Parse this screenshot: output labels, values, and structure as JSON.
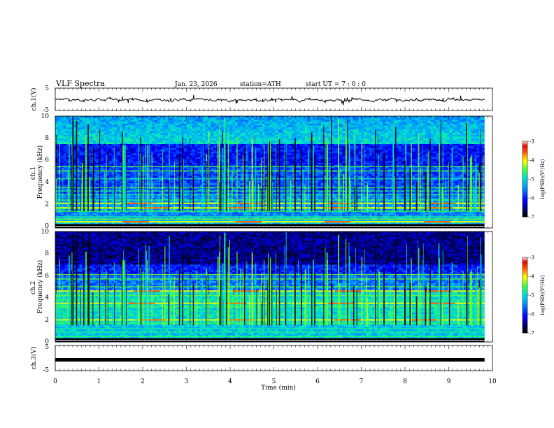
{
  "header": {
    "title": "VLF  Spectra",
    "date": "Jan. 23, 2026",
    "station": "station=ATH",
    "start": "start  UT  =   7 : 0  : 0"
  },
  "chart_data": [
    {
      "type": "line",
      "name": "ch1-waveform",
      "ylabel": "ch.1(V)",
      "ylim": [
        -5,
        5
      ],
      "yticks": [
        "5",
        "-5"
      ],
      "xlim": [
        0,
        10
      ],
      "grid": false,
      "trace_level": -0.2
    },
    {
      "type": "heatmap",
      "name": "ch1-spectrogram",
      "ylabel": "ch.1\nFrequency (kHz)",
      "xlim": [
        0,
        10
      ],
      "ylim": [
        0,
        10
      ],
      "yticks": [
        "0",
        "2",
        "4",
        "6",
        "8",
        "10"
      ],
      "data_end_min": 9.82,
      "bands_khz": [
        0.3,
        0.55,
        0.8,
        1.0,
        1.5,
        1.75,
        2.2,
        2.5,
        3.0,
        3.3,
        3.6,
        4.4,
        5.1,
        5.5
      ],
      "strong_band_khz": [
        0.55,
        1.8,
        2.2
      ],
      "colorbar": {
        "label": "log(PSD)(V²/Hz)",
        "range": [
          -7,
          -3
        ],
        "ticks": [
          "-3",
          "-4",
          "-5",
          "-6",
          "-7"
        ]
      }
    },
    {
      "type": "heatmap",
      "name": "ch2-spectrogram",
      "ylabel": "ch.2\nFrequency (kHz)",
      "xlim": [
        0,
        10
      ],
      "ylim": [
        0,
        10
      ],
      "yticks": [
        "0",
        "2",
        "4",
        "6",
        "8",
        "10"
      ],
      "data_end_min": 9.82,
      "bands_khz": [
        0.5,
        0.9,
        1.2,
        1.7,
        2.0,
        2.4,
        2.8,
        3.2,
        3.5,
        3.8,
        4.2,
        4.6,
        5.0,
        5.7,
        6.1
      ],
      "strong_band_khz": [
        2.0,
        3.5,
        4.6
      ],
      "colorbar": {
        "label": "log(PSD)(V²/Hz)",
        "range": [
          -7,
          -3
        ],
        "ticks": [
          "-3",
          "-4",
          "-5",
          "-6",
          "-7"
        ]
      }
    },
    {
      "type": "line",
      "name": "ch3-waveform",
      "ylabel": "ch.3(V)",
      "ylim": [
        -5,
        5
      ],
      "yticks": [
        "5",
        "-5"
      ],
      "xlim": [
        0,
        10
      ],
      "xlabel": "Time  (min)",
      "xticks": [
        "0",
        "1",
        "2",
        "3",
        "4",
        "5",
        "6",
        "7",
        "8",
        "9",
        "10"
      ],
      "trace_level": -0.7
    }
  ]
}
